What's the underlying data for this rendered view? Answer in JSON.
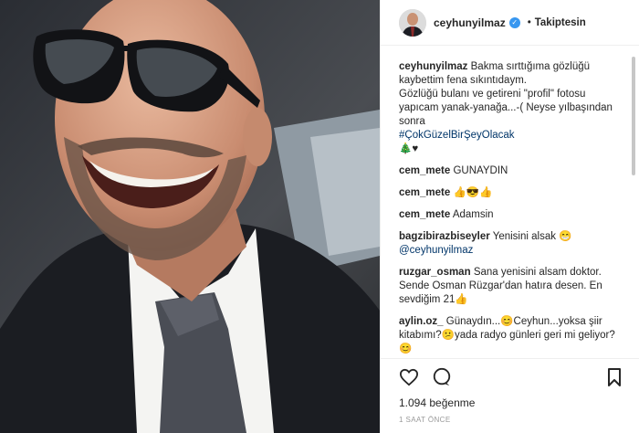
{
  "header": {
    "username": "ceyhunyilmaz",
    "separator": "•",
    "follow_status": "Takiptesin"
  },
  "caption": {
    "username": "ceyhunyilmaz",
    "line1": "Bakma sırttığıma gözlüğü kaybettim fena sıkıntıdaym.",
    "line2": "Gözlüğü bulanı ve getireni \"profil\" fotosu yapıcam yanak-yanağa...-( Neyse yılbaşından sonra",
    "hashtag": "#ÇokGüzelBirŞeyOlacak",
    "trailing": "🎄♥"
  },
  "comments": [
    {
      "username": "cem_mete",
      "text": "GUNAYDIN"
    },
    {
      "username": "cem_mete",
      "text": "👍😎👍"
    },
    {
      "username": "cem_mete",
      "text": "Adamsin"
    },
    {
      "username": "bagzibirazbiseyler",
      "text": "Yenisini alsak 😁",
      "mention": "@ceyhunyilmaz"
    },
    {
      "username": "ruzgar_osman",
      "text": "Sana yenisini alsam doktor. Sende Osman Rüzgar'dan hatıra desen. En sevdiğim 21👍"
    },
    {
      "username": "aylin.oz_",
      "text": "Günaydın...😊Ceyhun...yoksa şiir kitabımı?😕yada radyo günleri geri mi geliyor?😊"
    }
  ],
  "likes": {
    "count": "1.094",
    "label": "beğenme"
  },
  "timestamp": "1 SAAT ÖNCE",
  "icons": [
    "heart-icon",
    "comment-icon",
    "bookmark-icon",
    "verified-icon"
  ],
  "colors": {
    "verified": "#3897f0",
    "hashtag": "#003569",
    "muted": "#999999"
  }
}
